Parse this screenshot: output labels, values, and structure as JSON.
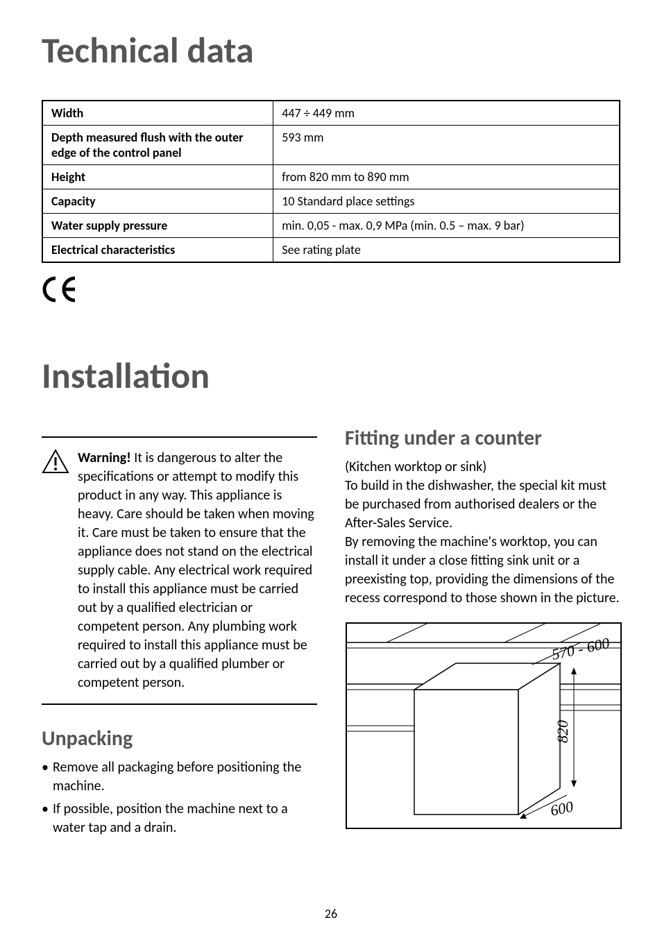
{
  "heading_technical": "Technical data",
  "table": {
    "rows": [
      {
        "label": "Width",
        "value": "447 ÷ 449  mm"
      },
      {
        "label": "Depth measured flush with the outer edge of the control panel",
        "value": "593 mm"
      },
      {
        "label": "Height",
        "value": "from 820 mm to 890 mm"
      },
      {
        "label": "Capacity",
        "value": "10 Standard place settings"
      },
      {
        "label": "Water supply pressure",
        "value": "min. 0,05 - max. 0,9 MPa (min. 0.5 – max. 9 bar)"
      },
      {
        "label": "Electrical characteristics",
        "value": "See rating plate"
      }
    ]
  },
  "ce_mark": "CE",
  "heading_installation": "Installation",
  "warning": {
    "bold": "Warning!",
    "text": " It is dangerous to alter the specifications or attempt to modify this product in any way. This appliance is heavy. Care should be taken when moving it. Care must be taken to ensure that the appliance does not stand on the electrical supply cable. Any electrical work required to install this appliance must be carried out by a qualified electrician or competent person. Any plumbing work required to install this appliance must be carried out by a qualified plumber or competent person."
  },
  "unpacking": {
    "heading": "Unpacking",
    "bullets": [
      "Remove all packaging before positioning the machine.",
      "If possible, position the machine next to a water tap and a drain."
    ]
  },
  "fitting": {
    "heading": "Fitting under a counter",
    "sub": "(Kitchen worktop or sink)",
    "para1": "To build in the dishwasher, the special kit must be purchased from authorised dealers or the After-Sales Service.",
    "para2": "By removing the machine's worktop, you can install it under a close fitting sink unit or a preexisting top, providing the dimensions of the recess correspond to those shown in the picture."
  },
  "chart_data": {
    "type": "diagram",
    "title": "Under-counter recess dimensions",
    "annotations": [
      {
        "label": "570 - 600",
        "meaning": "recess depth mm"
      },
      {
        "label": "820",
        "meaning": "recess height mm"
      },
      {
        "label": "600",
        "meaning": "recess width mm"
      }
    ]
  },
  "page_number": "26"
}
